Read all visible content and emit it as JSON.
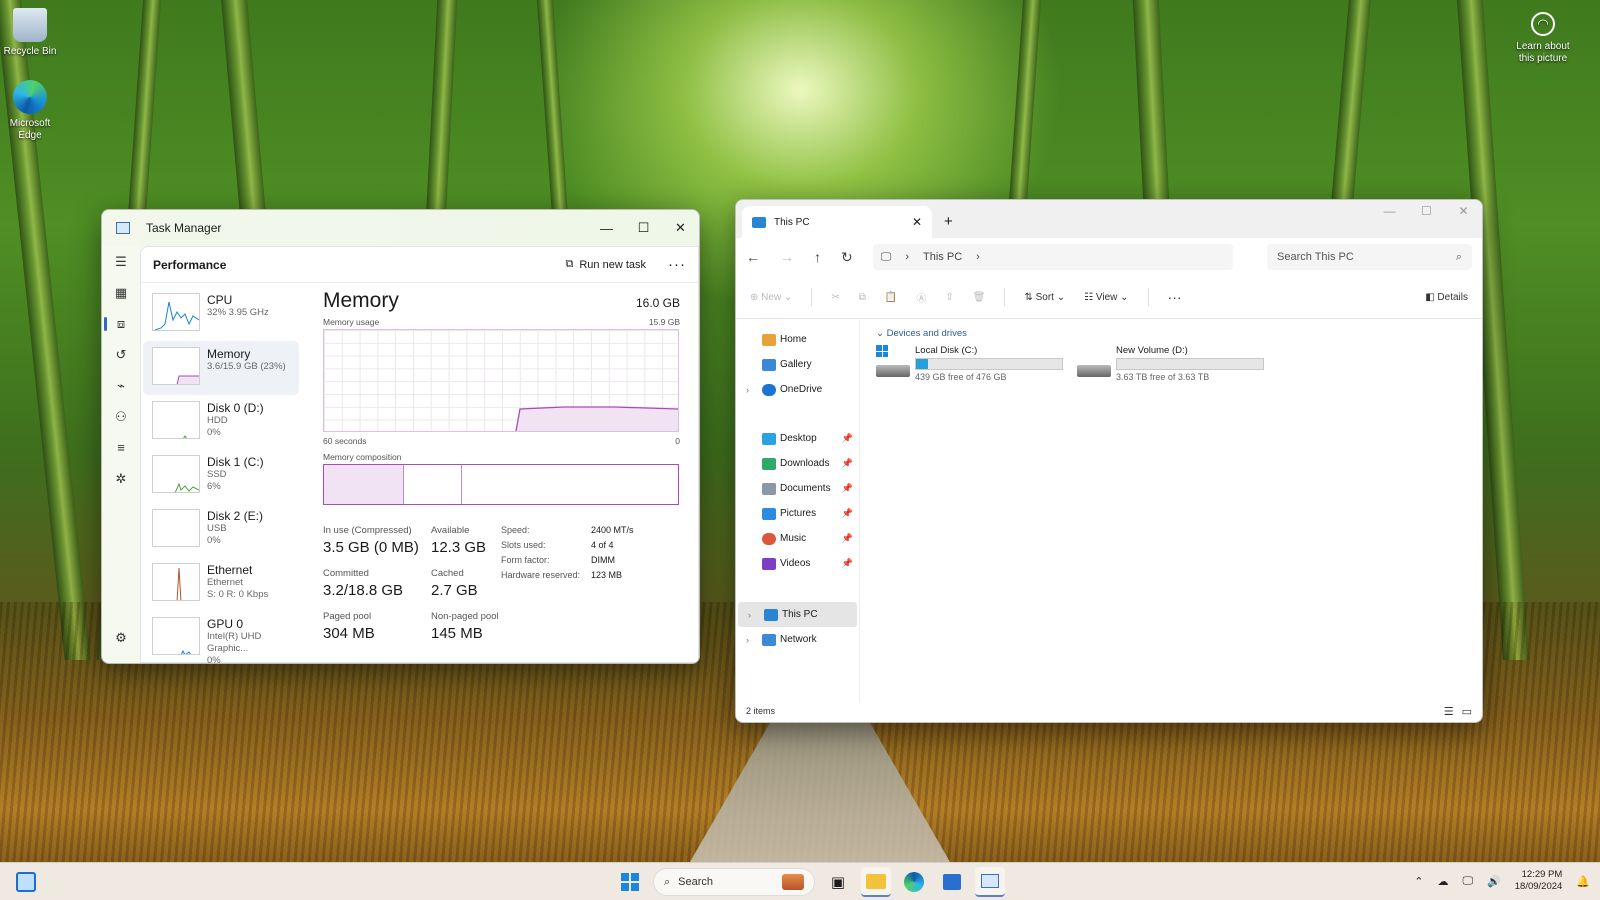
{
  "desktop": {
    "icons": [
      {
        "label": "Recycle Bin"
      },
      {
        "label": "Microsoft Edge"
      }
    ],
    "learn_about": "Learn about this picture"
  },
  "task_manager": {
    "title": "Task Manager",
    "header": "Performance",
    "run_task": "Run new task",
    "items": [
      {
        "name": "CPU",
        "sub1": "32%  3.95 GHz",
        "sub2": ""
      },
      {
        "name": "Memory",
        "sub1": "3.6/15.9 GB (23%)",
        "sub2": ""
      },
      {
        "name": "Disk 0 (D:)",
        "sub1": "HDD",
        "sub2": "0%"
      },
      {
        "name": "Disk 1 (C:)",
        "sub1": "SSD",
        "sub2": "6%"
      },
      {
        "name": "Disk 2 (E:)",
        "sub1": "USB",
        "sub2": "0%"
      },
      {
        "name": "Ethernet",
        "sub1": "Ethernet",
        "sub2": "S: 0  R: 0 Kbps"
      },
      {
        "name": "GPU 0",
        "sub1": "Intel(R) UHD Graphic...",
        "sub2": "0%"
      }
    ],
    "memory": {
      "title": "Memory",
      "capacity": "16.0 GB",
      "usage_label": "Memory usage",
      "usage_max": "15.9 GB",
      "time_label": "60 seconds",
      "time_min": "0",
      "composition_label": "Memory composition",
      "in_use_label": "In use (Compressed)",
      "in_use": "3.5 GB (0 MB)",
      "available_label": "Available",
      "available": "12.3 GB",
      "committed_label": "Committed",
      "committed": "3.2/18.8 GB",
      "cached_label": "Cached",
      "cached": "2.7 GB",
      "paged_label": "Paged pool",
      "paged": "304 MB",
      "nonpaged_label": "Non-paged pool",
      "nonpaged": "145 MB",
      "specs": [
        {
          "k": "Speed:",
          "v": "2400 MT/s"
        },
        {
          "k": "Slots used:",
          "v": "4 of 4"
        },
        {
          "k": "Form factor:",
          "v": "DIMM"
        },
        {
          "k": "Hardware reserved:",
          "v": "123 MB"
        }
      ]
    }
  },
  "explorer": {
    "tab": "This PC",
    "address": "This PC",
    "search_placeholder": "Search This PC",
    "cmd": {
      "new": "New",
      "sort": "Sort",
      "view": "View",
      "details": "Details"
    },
    "nav": {
      "home": "Home",
      "gallery": "Gallery",
      "onedrive": "OneDrive",
      "desktop": "Desktop",
      "downloads": "Downloads",
      "documents": "Documents",
      "pictures": "Pictures",
      "music": "Music",
      "videos": "Videos",
      "thispc": "This PC",
      "network": "Network"
    },
    "group": "Devices and drives",
    "drives": [
      {
        "name": "Local Disk (C:)",
        "free": "439 GB free of 476 GB",
        "used_fraction": 0.08
      },
      {
        "name": "New Volume (D:)",
        "free": "3.63 TB free of 3.63 TB",
        "used_fraction": 0.0
      }
    ],
    "status": "2 items"
  },
  "taskbar": {
    "search": "Search",
    "time": "12:29 PM",
    "date": "18/09/2024"
  }
}
